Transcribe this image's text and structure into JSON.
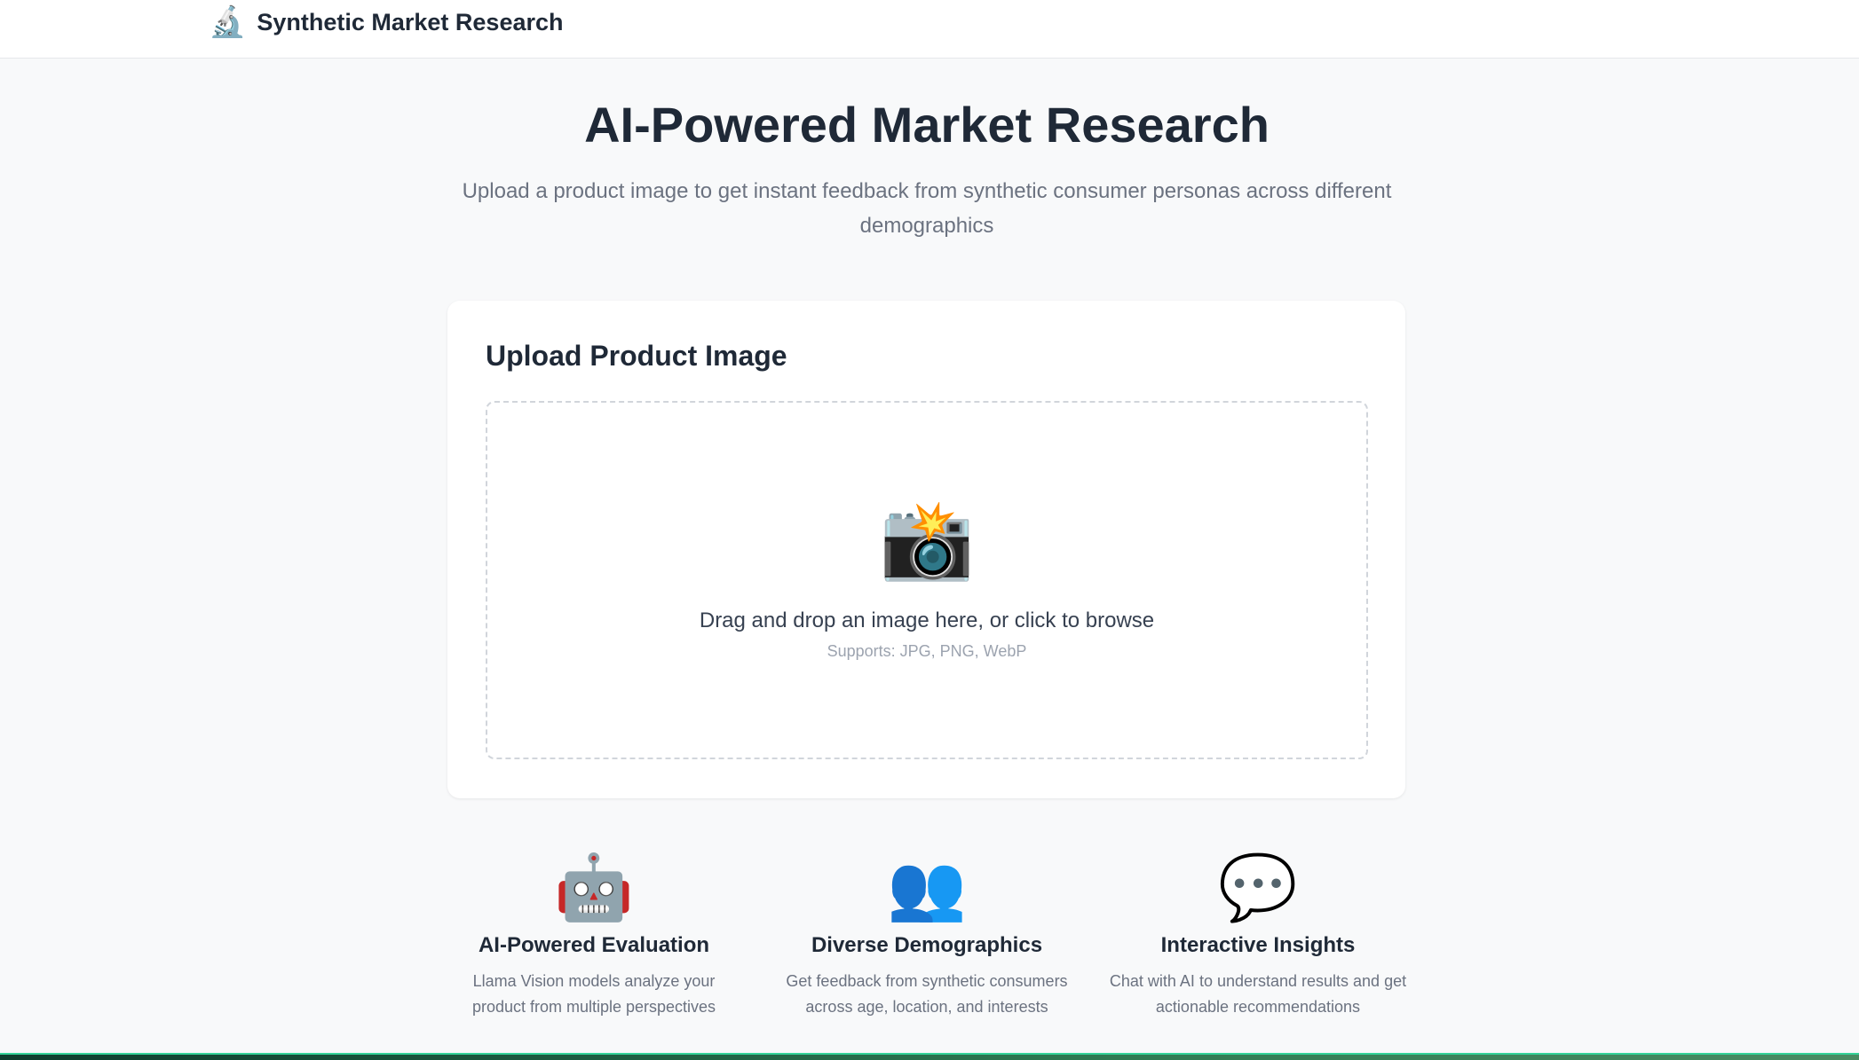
{
  "header": {
    "brand_icon": "microscope-icon",
    "brand_glyph": "🔬",
    "title": "Synthetic Market Research"
  },
  "hero": {
    "title": "AI-Powered Market Research",
    "subtitle": "Upload a product image to get instant feedback from synthetic consumer personas across different demographics"
  },
  "upload": {
    "card_title": "Upload Product Image",
    "icon": "camera-flash-icon",
    "glyph": "📸",
    "prompt": "Drag and drop an image here, or click to browse",
    "supports": "Supports: JPG, PNG, WebP"
  },
  "features": [
    {
      "icon": "robot-icon",
      "glyph": "🤖",
      "title": "AI-Powered Evaluation",
      "desc": "Llama Vision models analyze your product from multiple perspectives"
    },
    {
      "icon": "people-icon",
      "glyph": "👥",
      "title": "Diverse Demographics",
      "desc": "Get feedback from synthetic consumers across age, location, and interests"
    },
    {
      "icon": "speech-bubble-icon",
      "glyph": "💬",
      "title": "Interactive Insights",
      "desc": "Chat with AI to understand results and get actionable recommendations"
    }
  ],
  "colors": {
    "background": "#f8f9fa",
    "text": "#1f2937",
    "muted": "#6b7280",
    "accent_strip": "#34d399"
  }
}
